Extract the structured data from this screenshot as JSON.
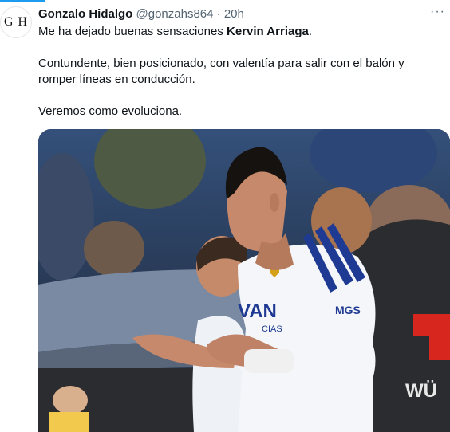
{
  "avatar": {
    "initials": "G H"
  },
  "tweet": {
    "author_name": "Gonzalo Hidalgo",
    "handle": "@gonzahs864",
    "separator": "·",
    "time": "20h",
    "more": "···",
    "line1_prefix": "Me ha dejado buenas sensaciones ",
    "line1_bold": "Kervin Arriaga",
    "line1_suffix": ".",
    "paragraph2": "Contundente, bien posicionado, con valentía para salir con el balón y romper líneas en conducción.",
    "paragraph3": "Veremos como evoluciona."
  },
  "media": {
    "jersey_sponsor": "VAN",
    "jersey_sponsor_sub": "CIAS",
    "sleeve_sponsor": "MGS",
    "bg_sponsor": "WÜ",
    "colors": {
      "jersey": "#f4f6fa",
      "stripe": "#1f3a93",
      "skin": "#c7896b",
      "hair": "#16120f",
      "bench_roof": "#7a8aa2",
      "bench_dark": "#2b2c30",
      "sponsor_red": "#d7261e"
    }
  }
}
